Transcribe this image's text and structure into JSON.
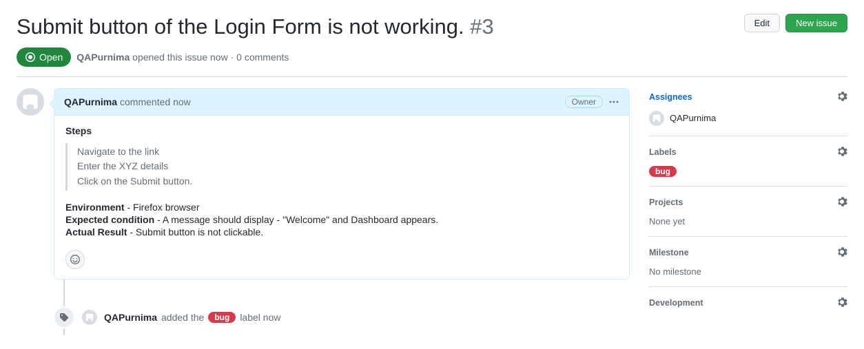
{
  "issue": {
    "title": "Submit button of the Login Form is not working.",
    "number": "#3",
    "state": "Open",
    "author": "QAPurnima",
    "opened_verb": "opened this issue",
    "opened_time": "now",
    "comments_count": "0 comments"
  },
  "actions": {
    "edit": "Edit",
    "new_issue": "New issue"
  },
  "comment": {
    "author": "QAPurnima",
    "verb": "commented",
    "time": "now",
    "owner_badge": "Owner",
    "steps_heading": "Steps",
    "steps": [
      "Navigate to the link",
      "Enter the XYZ details",
      "Click on the Submit button."
    ],
    "env_label": "Environment",
    "env_value": " - Firefox browser",
    "expected_label": "Expected condition",
    "expected_value": " - A message should display - \"Welcome\" and Dashboard appears.",
    "actual_label": "Actual Result",
    "actual_value": " - Submit button is not clickable."
  },
  "timeline": {
    "actor": "QAPurnima",
    "added_text": "added the",
    "label": "bug",
    "suffix": "label now"
  },
  "sidebar": {
    "assignees_title": "Assignees",
    "assignee_name": "QAPurnima",
    "labels_title": "Labels",
    "label_bug": "bug",
    "projects_title": "Projects",
    "projects_value": "None yet",
    "milestone_title": "Milestone",
    "milestone_value": "No milestone",
    "development_title": "Development"
  }
}
